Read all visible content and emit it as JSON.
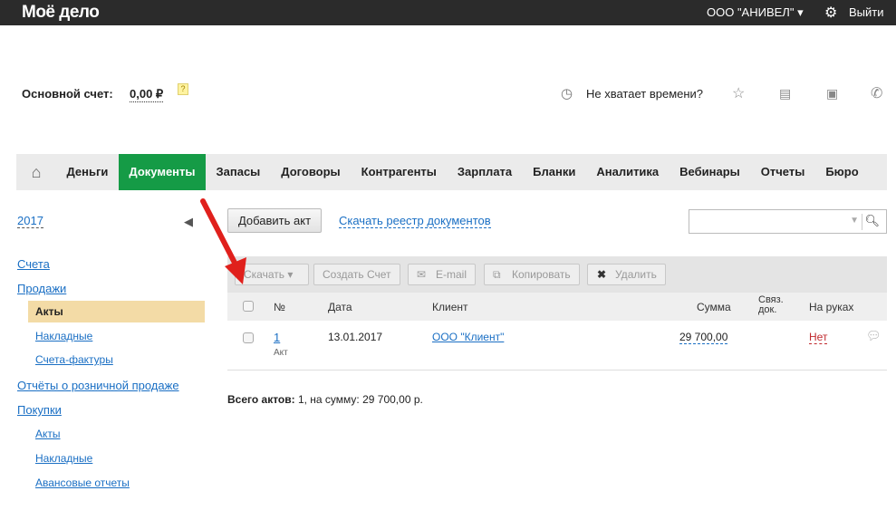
{
  "topbar": {
    "logo": "Моё дело",
    "org": "ООО \"АНИВЕЛ\" ▾",
    "logout": "Выйти"
  },
  "account": {
    "label": "Основной счет:",
    "value": "0,00 ₽",
    "help": "?"
  },
  "header_tools": {
    "no_time": "Не хватает времени?"
  },
  "nav": {
    "tabs": [
      "Деньги",
      "Документы",
      "Запасы",
      "Договоры",
      "Контрагенты",
      "Зарплата",
      "Бланки",
      "Аналитика",
      "Вебинары",
      "Отчеты",
      "Бюро"
    ],
    "active": "Документы"
  },
  "sidebar": {
    "year": "2017",
    "items": {
      "invoices": "Счета",
      "sales": "Продажи",
      "sales_acts": "Акты",
      "sales_waybills": "Накладные",
      "sales_facturas": "Счета-фактуры",
      "retail": "Отчёты о розничной продаже",
      "purchases": "Покупки",
      "purch_acts": "Акты",
      "purch_waybills": "Накладные",
      "advance": "Авансовые отчеты"
    }
  },
  "actions": {
    "add": "Добавить акт",
    "registry": "Скачать реестр документов",
    "search_placeholder": ""
  },
  "toolbar": {
    "download": "Скачать ▾",
    "create_invoice": "Создать Счет",
    "email": "E-mail",
    "copy": "Копировать",
    "delete": "Удалить"
  },
  "table": {
    "headers": {
      "num": "№",
      "date": "Дата",
      "client": "Клиент",
      "sum": "Сумма",
      "linked": "Связ. док.",
      "on_hand": "На руках"
    },
    "rows": [
      {
        "num": "1",
        "type": "Акт",
        "date": "13.01.2017",
        "client": "ООО \"Клиент\"",
        "sum": "29 700,00",
        "on_hand": "Нет"
      }
    ]
  },
  "total": {
    "label": "Всего актов:",
    "text": " 1, на сумму: 29 700,00 р."
  },
  "colors": {
    "accent": "#159b46",
    "link": "#1a6fc4",
    "topbar": "#2b2b2b",
    "negative": "#c0282d",
    "annotation_arrow": "#e0201c"
  }
}
